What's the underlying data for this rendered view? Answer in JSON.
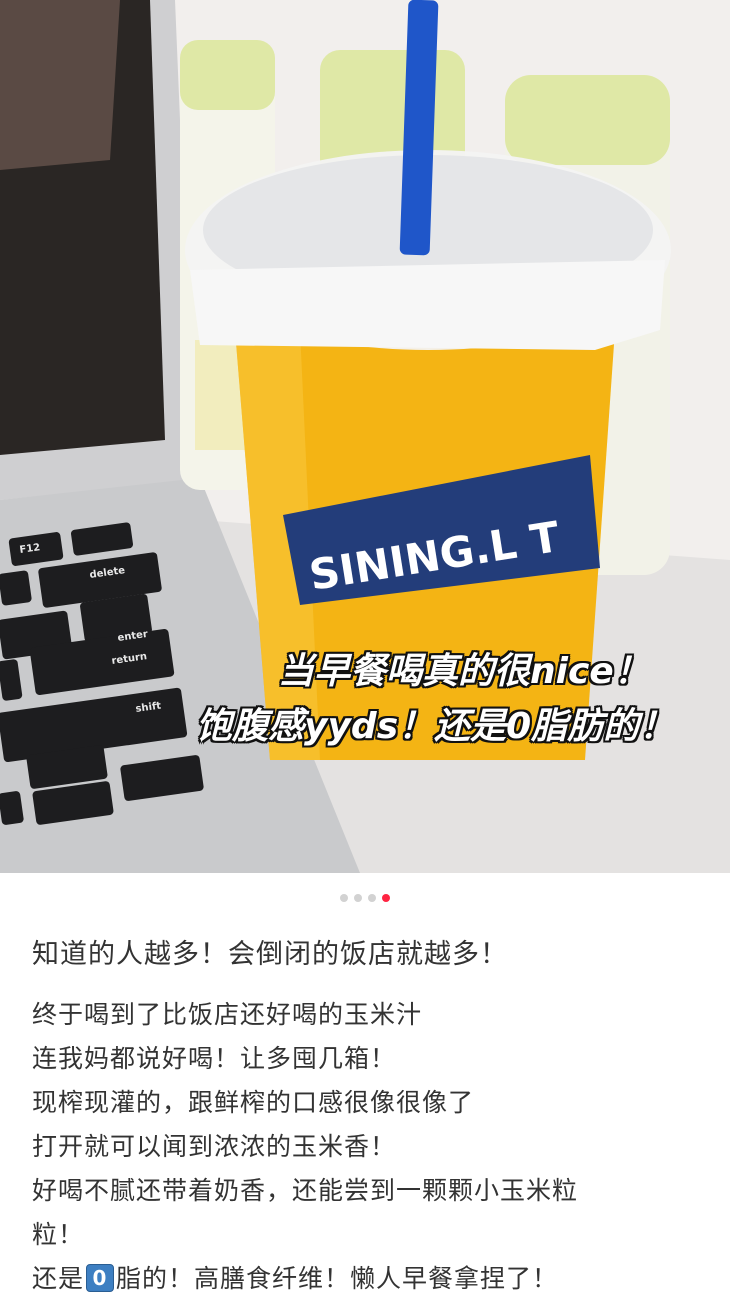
{
  "photo": {
    "overlay_line1": "当早餐喝真的很nice！",
    "overlay_line2": "饱腹感yyds！还是0脂肪的！",
    "cup_label": "SINING.L T",
    "keyboard_keys": {
      "f12": "F12",
      "delete": "delete",
      "enter": "enter",
      "return": "return",
      "shift": "shift"
    }
  },
  "carousel": {
    "total": 4,
    "active_index": 3
  },
  "post": {
    "title": "知道的人越多！会倒闭的饭店就越多！",
    "body_lines": [
      "终于喝到了比饭店还好喝的玉米汁",
      "连我妈都说好喝！让多囤几箱！",
      "现榨现灌的，跟鲜榨的口感很像很像了",
      "打开就可以闻到浓浓的玉米香！",
      "好喝不腻还带着奶香，还能尝到一颗颗小玉米粒",
      "粒！"
    ],
    "last_line_prefix": "还是",
    "last_line_badge": "0",
    "last_line_suffix": "脂的！高膳食纤维！懒人早餐拿捏了！"
  },
  "colors": {
    "accent": "#ff2442",
    "juice": "#f5b400",
    "label_blue": "#233d7a"
  }
}
